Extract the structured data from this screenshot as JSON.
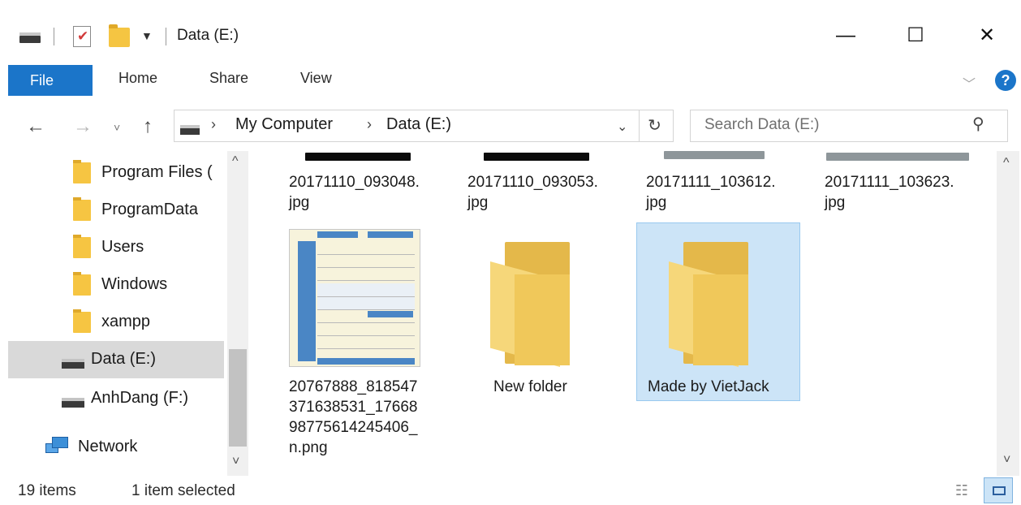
{
  "window": {
    "title": "Data (E:)",
    "controls": {
      "minimize": "—",
      "maximize": "☐",
      "close": "✕"
    }
  },
  "ribbon": {
    "tabs": [
      "File",
      "Home",
      "Share",
      "View"
    ]
  },
  "nav": {
    "breadcrumb": [
      "My Computer",
      "Data (E:)"
    ],
    "search_placeholder": "Search Data (E:)"
  },
  "sidebar": {
    "folders": [
      "Program Files (",
      "ProgramData",
      "Users",
      "Windows",
      "xampp"
    ],
    "drives": [
      "Data (E:)",
      "AnhDang (F:)"
    ],
    "network": "Network",
    "selected": "Data (E:)"
  },
  "content": {
    "top_row": [
      {
        "caption": "20171110_093048.\njpg"
      },
      {
        "caption": "20171110_093053.\njpg"
      },
      {
        "caption": "20171111_103612.\njpg"
      },
      {
        "caption": "20171111_103623.\njpg"
      }
    ],
    "png_file": "20767888_818547\n371638531_17668\n98775614245406_\nn.png",
    "folder1": "New folder",
    "folder2": "Made by VietJack",
    "selected": "Made by VietJack"
  },
  "status": {
    "items": "19 items",
    "selection": "1 item selected"
  },
  "colors": {
    "accent": "#1b75c9",
    "selection": "#cce4f7",
    "folder": "#f6d77a"
  }
}
